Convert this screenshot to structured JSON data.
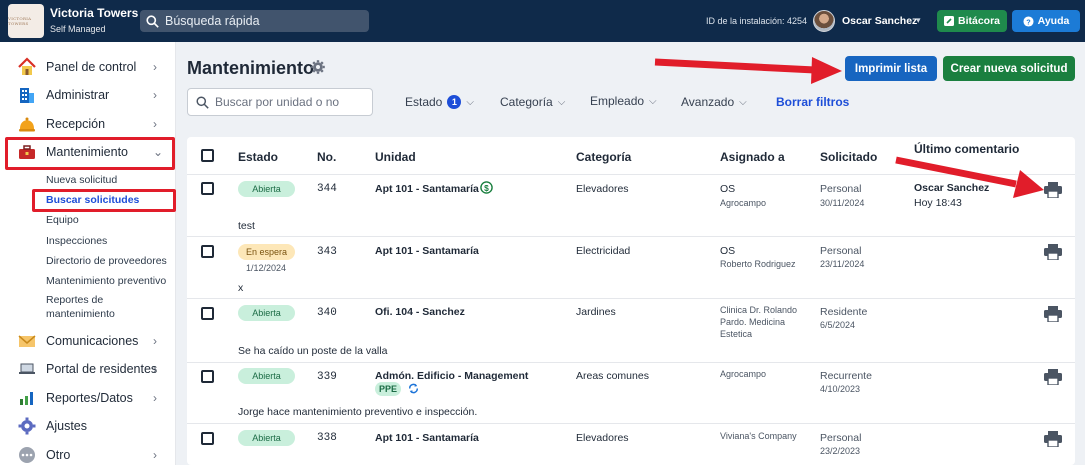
{
  "topbar": {
    "logo_text": "VICTORIA TOWERS",
    "org_name": "Victoria Towers",
    "org_sub": "Self Managed",
    "search_placeholder": "Búsqueda rápida",
    "install_id": "ID de la instalación: 4254",
    "user_name": "Oscar Sanchez",
    "bitacora_label": "Bitácora",
    "ayuda_label": "Ayuda"
  },
  "sidebar": {
    "items": [
      {
        "label": "Panel de control",
        "icon": "house-icon"
      },
      {
        "label": "Administrar",
        "icon": "building-icon"
      },
      {
        "label": "Recepción",
        "icon": "bell-icon"
      },
      {
        "label": "Mantenimiento",
        "icon": "toolbox-icon"
      },
      {
        "label": "Comunicaciones",
        "icon": "envelope-icon"
      },
      {
        "label": "Portal de residentes",
        "icon": "laptop-icon"
      },
      {
        "label": "Reportes/Datos",
        "icon": "bar-chart-icon"
      },
      {
        "label": "Ajustes",
        "icon": "gear-icon"
      },
      {
        "label": "Otro",
        "icon": "more-icon"
      }
    ],
    "subitems": [
      "Nueva solicitud",
      "Buscar solicitudes",
      "Equipo",
      "Inspecciones",
      "Directorio de proveedores",
      "Mantenimiento preventivo",
      "Reportes de",
      "mantenimiento"
    ]
  },
  "main": {
    "title": "Mantenimiento",
    "print_list_label": "Imprimir lista",
    "new_request_label": "Crear nueva solicitud",
    "search_placeholder": "Buscar por unidad o no",
    "filters": {
      "estado": "Estado",
      "estado_count": "1",
      "categoria": "Categoría",
      "empleado": "Empleado",
      "avanzado": "Avanzado",
      "clear": "Borrar filtros"
    },
    "columns": [
      "Estado",
      "No.",
      "Unidad",
      "Categoría",
      "Asignado a",
      "Solicitado",
      "Último comentario"
    ],
    "rows": [
      {
        "status": "Abierta",
        "status_date": "",
        "no": "344",
        "unit": "Apt 101 - Santamaría",
        "category": "Elevadores",
        "assigned": "OS",
        "assigned_sub": "Agrocampo",
        "requested": "Personal",
        "requested_date": "30/11/2024",
        "comment_author": "Oscar Sanchez",
        "comment_time": "Hoy 18:43",
        "description": "test"
      },
      {
        "status": "En espera",
        "status_date": "1/12/2024",
        "no": "343",
        "unit": "Apt 101 - Santamaría",
        "category": "Electricidad",
        "assigned": "OS",
        "assigned_sub": "Roberto Rodriguez",
        "requested": "Personal",
        "requested_date": "23/11/2024",
        "comment_author": "",
        "comment_time": "",
        "description": "x"
      },
      {
        "status": "Abierta",
        "status_date": "",
        "no": "340",
        "unit": "Ofi. 104 - Sanchez",
        "category": "Jardines",
        "assigned": "Clinica Dr. Rolando",
        "assigned_sub": "Pardo. Medicina",
        "assigned_sub2": "Estetica",
        "requested": "Residente",
        "requested_date": "6/5/2024",
        "comment_author": "",
        "comment_time": "",
        "description": "Se ha caído un poste de la valla"
      },
      {
        "status": "Abierta",
        "status_date": "",
        "no": "339",
        "unit": "Admón. Edificio - Management",
        "unit_badge": "PPE",
        "category": "Areas comunes",
        "assigned": "Agrocampo",
        "assigned_sub": "",
        "requested": "Recurrente",
        "requested_date": "4/10/2023",
        "comment_author": "",
        "comment_time": "",
        "description": "Jorge hace mantenimiento preventivo e inspección."
      },
      {
        "status": "Abierta",
        "status_date": "",
        "no": "338",
        "unit": "Apt 101 - Santamaría",
        "category": "Elevadores",
        "assigned": "Viviana's Company",
        "assigned_sub": "",
        "requested": "Personal",
        "requested_date": "23/2/2023",
        "comment_author": "",
        "comment_time": "",
        "description": ""
      }
    ]
  },
  "colors": {
    "topbar": "#0f2a4a",
    "primary_blue": "#1765c0",
    "primary_green": "#1a7f3f",
    "highlight_red": "#e11d2a",
    "open_pill": "#c9efdc",
    "hold_pill": "#fde7b8"
  }
}
